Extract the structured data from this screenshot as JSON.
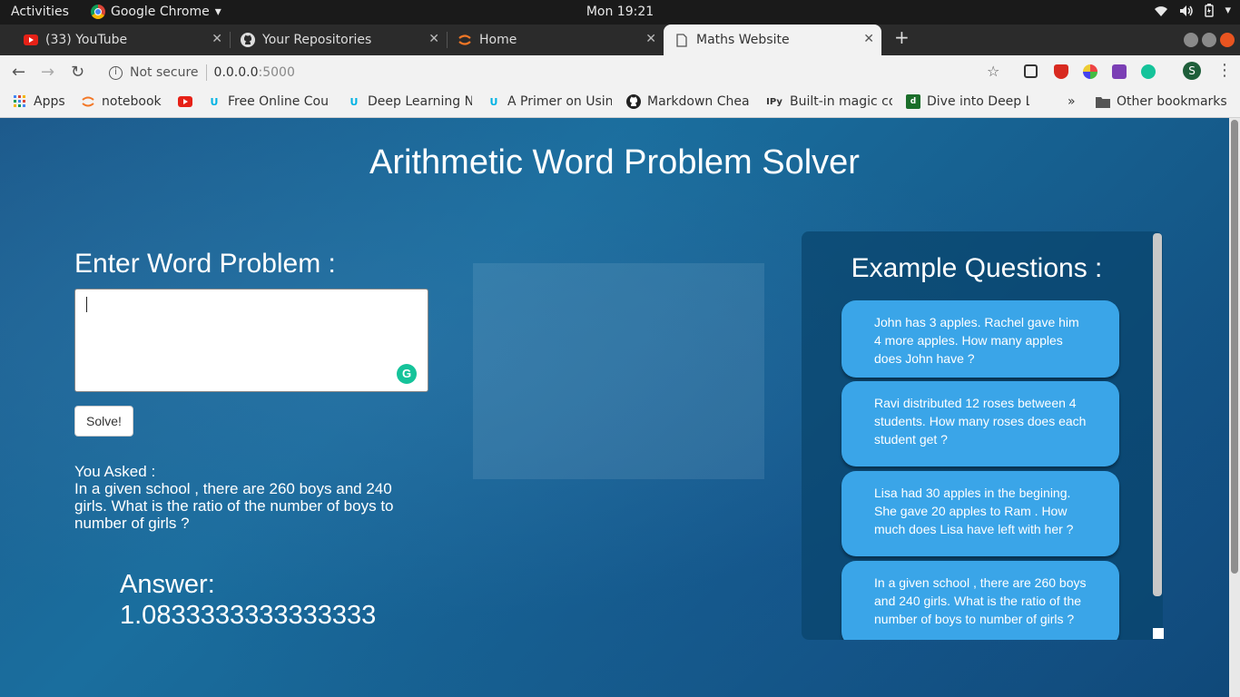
{
  "system_bar": {
    "activities": "Activities",
    "app_name": "Google Chrome",
    "clock": "Mon 19:21"
  },
  "tabs": [
    {
      "label": "(33) YouTube",
      "icon": "youtube-icon"
    },
    {
      "label": "Your Repositories",
      "icon": "github-icon"
    },
    {
      "label": "Home",
      "icon": "jupyter-icon"
    },
    {
      "label": "Maths Website",
      "icon": "page-icon",
      "active": true
    }
  ],
  "address": {
    "security": "Not secure",
    "host": "0.0.0.0",
    "port": ":5000"
  },
  "bookmarks": [
    {
      "label": "Apps",
      "icon": "apps-grid-icon"
    },
    {
      "label": "notebook",
      "icon": "jupyter-icon"
    },
    {
      "label": "",
      "icon": "youtube-icon"
    },
    {
      "label": "Free Online Cou",
      "icon": "udacity-icon"
    },
    {
      "label": "Deep Learning N",
      "icon": "udacity-icon"
    },
    {
      "label": "A Primer on Usin",
      "icon": "udacity-icon"
    },
    {
      "label": "Markdown Chea",
      "icon": "github-icon"
    },
    {
      "label": "Built-in magic co",
      "icon": "ipython-icon"
    },
    {
      "label": "Dive into Deep L",
      "icon": "d2l-icon"
    }
  ],
  "bookmarks_overflow": "»",
  "other_bookmarks": "Other bookmarks",
  "profile_initial": "S",
  "page": {
    "title": "Arithmetic Word Problem Solver",
    "enter_label": "Enter Word Problem :",
    "input_value": "",
    "solve_label": "Solve!",
    "asked_label": "You Asked :",
    "asked_text": "In a given school , there are 260 boys and 240 girls. What is the ratio of the number of boys to number of girls ?",
    "answer_label": "Answer:",
    "answer_value": "1.0833333333333333",
    "examples_title": "Example Questions :",
    "examples": [
      "John has 3 apples. Rachel gave him 4 more apples. How many apples does John have ?",
      "Ravi distributed 12 roses between 4 students. How many roses does each student get ?",
      "Lisa had 30 apples in the begining. She gave 20 apples to Ram . How much does Lisa have left with her ?",
      "In a given school , there are 260 boys and 240 girls. What is the ratio of the number of boys to number of girls ?"
    ]
  },
  "colors": {
    "page_bg": "#1a6e9e",
    "card_bg": "#3aa5e8",
    "panel_bg": "#0a466e",
    "grammarly": "#15c39a"
  }
}
